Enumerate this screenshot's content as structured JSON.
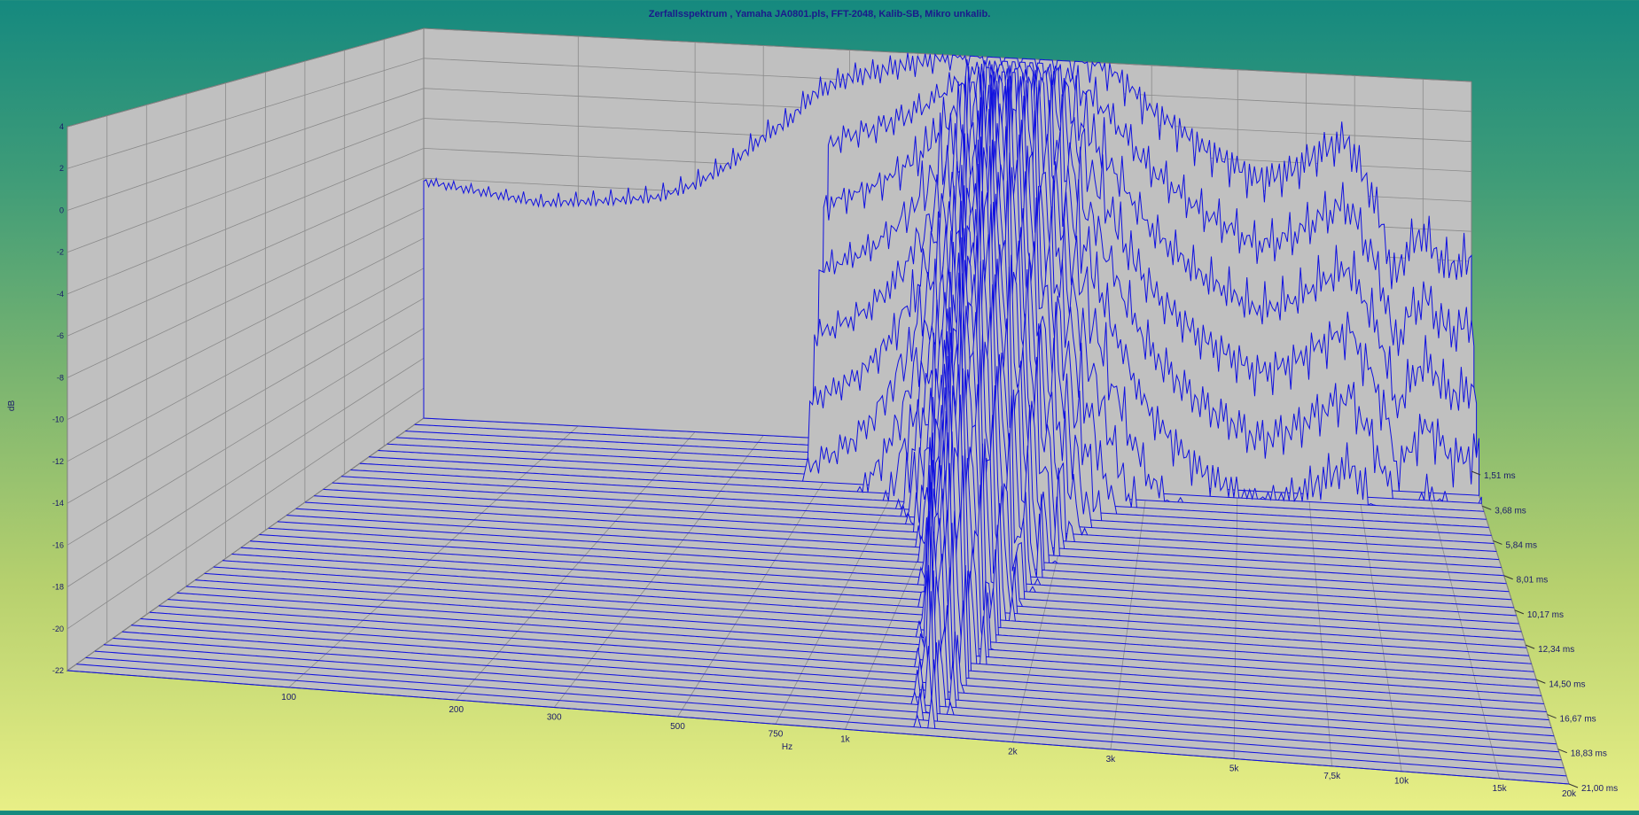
{
  "chart_data": {
    "type": "waterfall-3d",
    "title": "Zerfallsspektrum , Yamaha JA0801.pls, FFT-2048, Kalib-SB, Mikro unkalib.",
    "xlabel": "Hz",
    "ylabel": "dB",
    "zlabel": "",
    "x_scale": "log",
    "xlim": [
      40,
      20000
    ],
    "ylim": [
      -22,
      4
    ],
    "zlim": [
      1.51,
      21.0
    ],
    "x_ticks": [
      {
        "value": 100,
        "label": "100"
      },
      {
        "value": 200,
        "label": "200"
      },
      {
        "value": 300,
        "label": "300"
      },
      {
        "value": 500,
        "label": "500"
      },
      {
        "value": 750,
        "label": "750"
      },
      {
        "value": 1000,
        "label": "1k"
      },
      {
        "value": 2000,
        "label": "2k"
      },
      {
        "value": 3000,
        "label": "3k"
      },
      {
        "value": 5000,
        "label": "5k"
      },
      {
        "value": 7500,
        "label": "7,5k"
      },
      {
        "value": 10000,
        "label": "10k"
      },
      {
        "value": 15000,
        "label": "15k"
      },
      {
        "value": 20000,
        "label": "20k"
      }
    ],
    "y_ticks": [
      4,
      2,
      0,
      -2,
      -4,
      -6,
      -8,
      -10,
      -12,
      -14,
      -16,
      -18,
      -20,
      -22
    ],
    "z_ticks": [
      {
        "value": 1.51,
        "label": "1,51 ms"
      },
      {
        "value": 3.68,
        "label": "3,68 ms"
      },
      {
        "value": 5.84,
        "label": "5,84 ms"
      },
      {
        "value": 8.01,
        "label": "8,01 ms"
      },
      {
        "value": 10.17,
        "label": "10,17 ms"
      },
      {
        "value": 12.34,
        "label": "12,34 ms"
      },
      {
        "value": 14.5,
        "label": "14,50 ms"
      },
      {
        "value": 16.67,
        "label": "16,67 ms"
      },
      {
        "value": 18.83,
        "label": "18,83 ms"
      },
      {
        "value": 21.0,
        "label": "21,00 ms"
      }
    ],
    "slice_count": 40,
    "floor_db": -22,
    "first_slice_response": [
      [
        40,
        -6.2
      ],
      [
        80,
        -7.2
      ],
      [
        120,
        -6.8
      ],
      [
        160,
        -6.4
      ],
      [
        200,
        -5.4
      ],
      [
        250,
        -3.8
      ],
      [
        300,
        -2.0
      ],
      [
        350,
        -0.8
      ],
      [
        400,
        0.9
      ],
      [
        450,
        1.7
      ],
      [
        500,
        2.2
      ],
      [
        550,
        2.5
      ],
      [
        600,
        2.7
      ],
      [
        650,
        3.0
      ],
      [
        700,
        3.2
      ],
      [
        750,
        3.4
      ],
      [
        800,
        3.6
      ],
      [
        900,
        4.0
      ],
      [
        1000,
        4.2
      ],
      [
        1100,
        4.3
      ],
      [
        1200,
        4.4
      ],
      [
        1300,
        4.5
      ],
      [
        1500,
        4.5
      ],
      [
        1700,
        4.4
      ],
      [
        2000,
        4.2
      ],
      [
        2300,
        3.6
      ],
      [
        2600,
        2.5
      ],
      [
        3000,
        0.9
      ],
      [
        3500,
        -0.2
      ],
      [
        4000,
        -1.3
      ],
      [
        4500,
        -2.0
      ],
      [
        5000,
        -2.6
      ],
      [
        5500,
        -3.3
      ],
      [
        6000,
        -3.2
      ],
      [
        7000,
        -2.5
      ],
      [
        8000,
        -1.4
      ],
      [
        9000,
        -0.6
      ],
      [
        9500,
        -0.3
      ],
      [
        10000,
        -1.4
      ],
      [
        11000,
        -3.6
      ],
      [
        12000,
        -6.6
      ],
      [
        12500,
        -9.5
      ],
      [
        13000,
        -8.6
      ],
      [
        14000,
        -7.0
      ],
      [
        15000,
        -6.2
      ],
      [
        16000,
        -7.3
      ],
      [
        17000,
        -8.2
      ],
      [
        18000,
        -8.3
      ],
      [
        19000,
        -8.0
      ],
      [
        20000,
        -7.8
      ]
    ],
    "colors": {
      "line": "#1010e0",
      "wall": "#c0c0c0",
      "grid": "#8a8a8a",
      "title": "#1a1a8c"
    }
  }
}
